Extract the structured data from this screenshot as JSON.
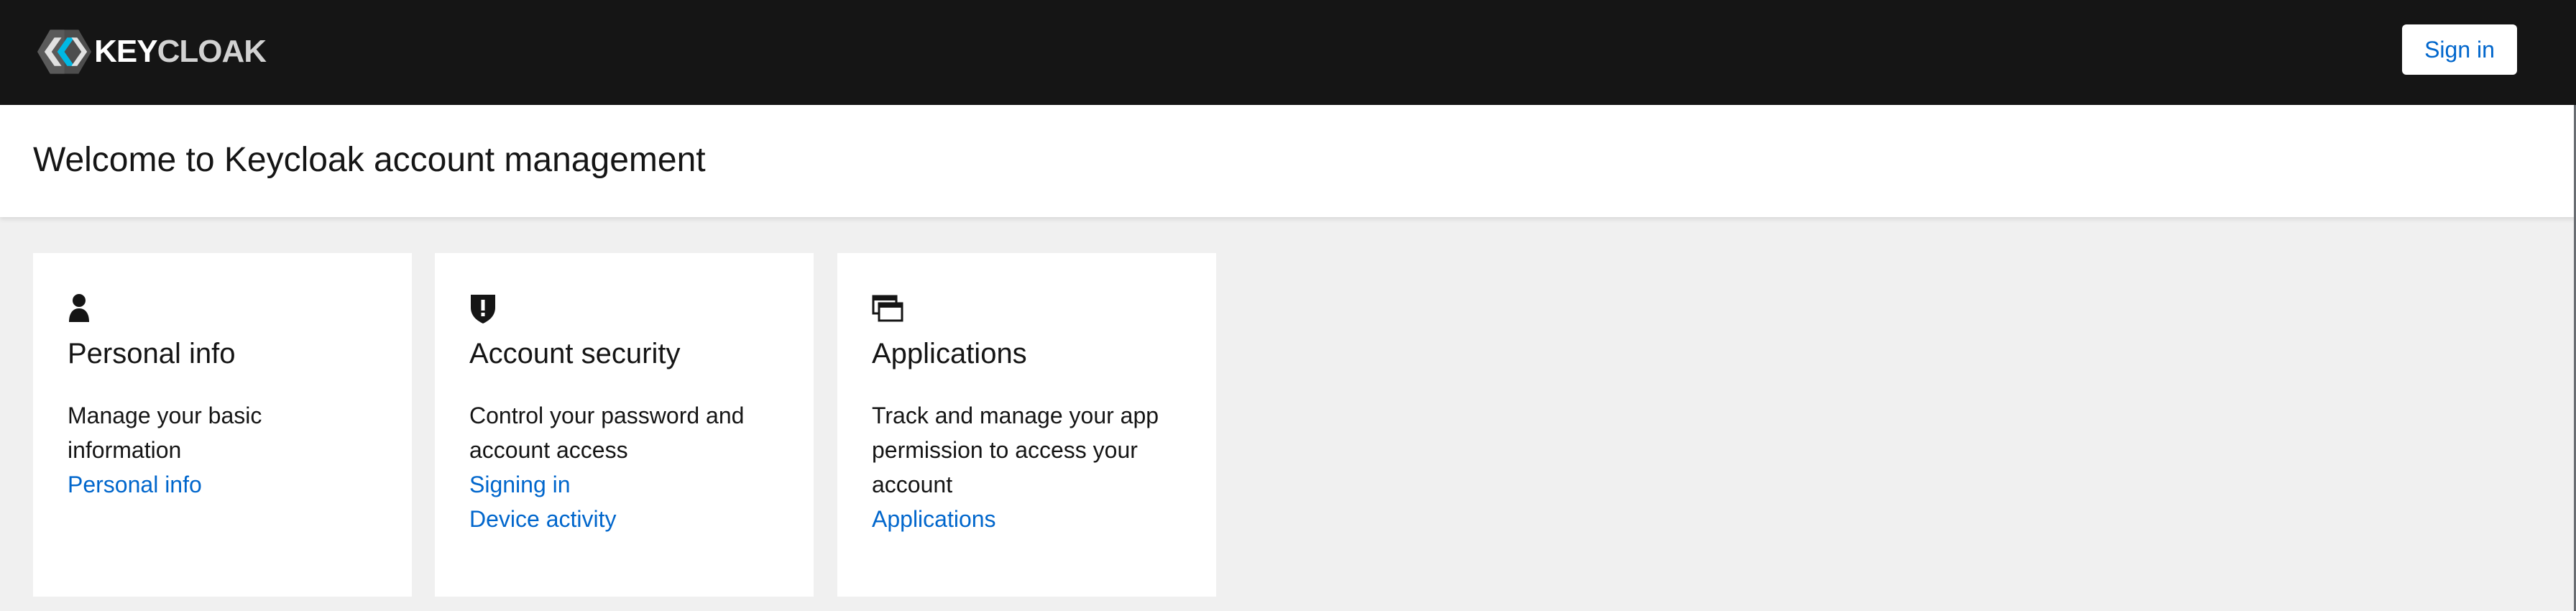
{
  "header": {
    "brand": {
      "main": "KEY",
      "dim": "CLOAK"
    },
    "sign_in_label": "Sign in"
  },
  "page": {
    "title": "Welcome to Keycloak account management"
  },
  "cards": [
    {
      "icon": "user-icon",
      "title": "Personal info",
      "description": "Manage your basic information",
      "links": [
        "Personal info"
      ]
    },
    {
      "icon": "shield-icon",
      "title": "Account security",
      "description": "Control your password and account access",
      "links": [
        "Signing in",
        "Device activity"
      ]
    },
    {
      "icon": "applications-icon",
      "title": "Applications",
      "description": "Track and manage your app permission to access your account",
      "links": [
        "Applications"
      ]
    }
  ],
  "colors": {
    "header_bg": "#151515",
    "page_bg": "#f0f0f0",
    "link": "#0066cc",
    "text": "#151515"
  }
}
